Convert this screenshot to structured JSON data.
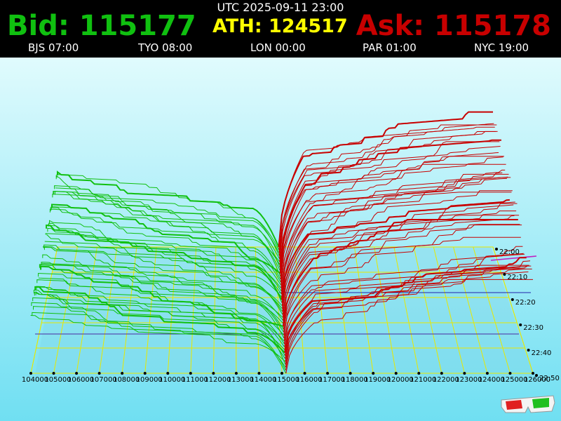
{
  "header": {
    "utc": "UTC 2025-09-11 23:00",
    "bid": "Bid: 115177",
    "ath": "ATH: 124517",
    "ask": "Ask: 115178",
    "cities": [
      "BJS 07:00",
      "TYO 08:00",
      "LON 00:00",
      "PAR 01:00",
      "NYC 19:00"
    ]
  },
  "colors": {
    "bid": "#10c010",
    "ask": "#c80000",
    "ath": "#ffff00",
    "grid": "#e8e800",
    "sky_top": "#e0fbfd",
    "sky_bottom": "#70dff2"
  },
  "icons": {
    "glasses": "3d-glasses-icon"
  },
  "chart_data": {
    "type": "area",
    "title": "",
    "x_axis": {
      "ticks": [
        "104000",
        "105000",
        "106000",
        "107000",
        "108000",
        "109000",
        "110000",
        "111000",
        "112000",
        "113000",
        "114000",
        "115000",
        "116000",
        "117000",
        "118000",
        "119000",
        "120000",
        "121000",
        "122000",
        "123000",
        "124000",
        "125000",
        "126000"
      ],
      "range": [
        104000,
        126000
      ]
    },
    "time_axis": {
      "ticks": [
        "22:00",
        "22:10",
        "22:20",
        "22:30",
        "22:40",
        "22:50"
      ]
    },
    "series": [
      {
        "name": "Bid",
        "side": "bid",
        "price_range": [
          104000,
          115177
        ]
      },
      {
        "name": "Ask",
        "side": "ask",
        "price_range": [
          115178,
          126000
        ]
      }
    ]
  }
}
